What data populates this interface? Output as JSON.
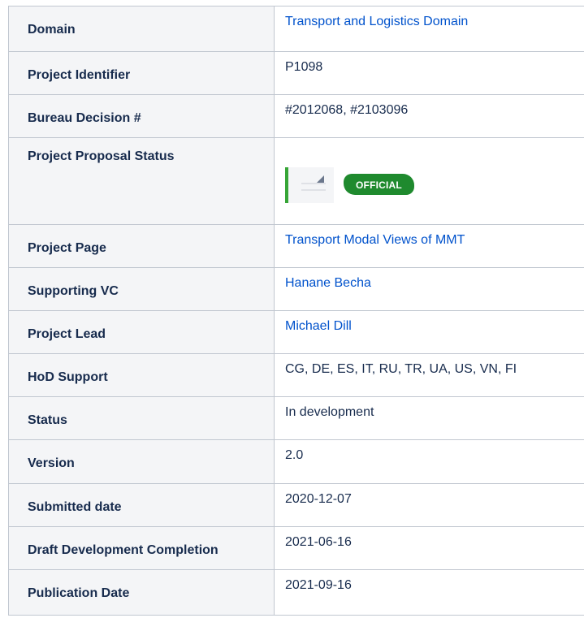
{
  "rows": [
    {
      "label": "Domain",
      "value": "Transport and Logistics Domain",
      "link": true
    },
    {
      "label": "Project Identifier",
      "value": "P1098",
      "link": false
    },
    {
      "label": "Bureau Decision #",
      "value": "#2012068, #2103096",
      "link": false
    },
    {
      "label": "Project Proposal Status",
      "badge": "OFFICIAL",
      "thumb_icon": "document-thumbnail-icon"
    },
    {
      "label": "Project Page",
      "value": "Transport Modal Views of MMT",
      "link": true
    },
    {
      "label": "Supporting VC",
      "value": "Hanane Becha",
      "link": true
    },
    {
      "label": "Project Lead",
      "value": "Michael Dill",
      "link": true
    },
    {
      "label": "HoD Support",
      "value": "CG, DE, ES, IT, RU, TR, UA, US, VN, FI",
      "link": false
    },
    {
      "label": "Status",
      "value": "In development",
      "link": false
    },
    {
      "label": "Version",
      "value": "2.0",
      "link": false
    },
    {
      "label": "Submitted date",
      "value": "2020-12-07",
      "link": false
    },
    {
      "label": "Draft Development Completion",
      "value": "2021-06-16",
      "link": false
    },
    {
      "label": "Publication Date",
      "value": "2021-09-16",
      "link": false
    }
  ],
  "colors": {
    "link": "#0052cc",
    "header_bg": "#f4f5f7",
    "border": "#c1c7d0",
    "badge_bg": "#1f8a2e",
    "thumb_accent": "#36a536"
  }
}
